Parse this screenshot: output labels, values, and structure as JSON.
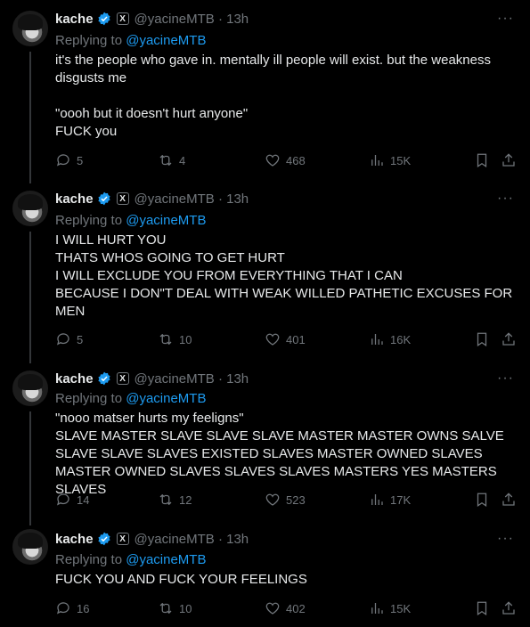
{
  "tweets": [
    {
      "name": "kache",
      "handle": "@yacineMTB · 13h",
      "replying_label": "Replying to ",
      "replying_to": "@yacineMTB",
      "text": "it's the people who gave in. mentally ill people will exist. but the weakness disgusts me\n\n\"oooh but it doesn't hurt anyone\"\nFUCK you",
      "replies": "5",
      "reposts": "4",
      "likes": "468",
      "views": "15K"
    },
    {
      "name": "kache",
      "handle": "@yacineMTB · 13h",
      "replying_label": "Replying to ",
      "replying_to": "@yacineMTB",
      "text": "I WILL HURT YOU\nTHATS WHOS GOING TO GET HURT\nI WILL EXCLUDE YOU FROM EVERYTHING THAT I CAN\nBECAUSE I DON\"T DEAL WITH WEAK WILLED PATHETIC EXCUSES FOR MEN",
      "replies": "5",
      "reposts": "10",
      "likes": "401",
      "views": "16K"
    },
    {
      "name": "kache",
      "handle": "@yacineMTB · 13h",
      "replying_label": "Replying to ",
      "replying_to": "@yacineMTB",
      "text": "\"nooo matser hurts my feeligns\"\nSLAVE MASTER SLAVE SLAVE SLAVE MASTER MASTER OWNS SALVE SLAVE SLAVE SLAVES EXISTED SLAVES MASTER OWNED SLAVES MASTER OWNED SLAVES SLAVES SLAVES MASTERS YES MASTERS SLAVES",
      "replies": "14",
      "reposts": "12",
      "likes": "523",
      "views": "17K"
    },
    {
      "name": "kache",
      "handle": "@yacineMTB · 13h",
      "replying_label": "Replying to ",
      "replying_to": "@yacineMTB",
      "text": "FUCK YOU AND FUCK YOUR FEELINGS",
      "replies": "16",
      "reposts": "10",
      "likes": "402",
      "views": "15K"
    }
  ],
  "icons": {
    "verified": "verified-badge-icon",
    "x_badge": "X",
    "more": "···"
  },
  "colors": {
    "accent": "#1d9bf0",
    "muted": "#71767b",
    "text": "#e7e9ea",
    "bg": "#000000"
  }
}
